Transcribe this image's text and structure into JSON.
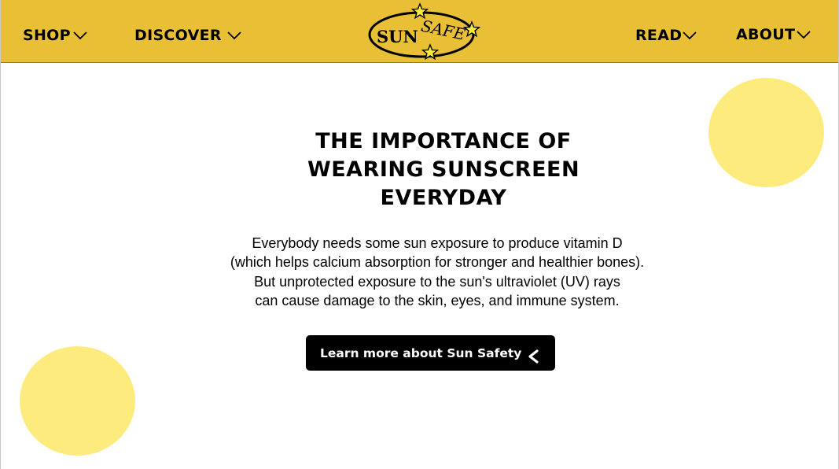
{
  "nav": {
    "shop": "SHOP",
    "discover": "DISCOVER",
    "read": "READ",
    "about": "ABOUT"
  },
  "logo": {
    "sun": "SUN",
    "safe": "SAFE"
  },
  "hero": {
    "title_lines": [
      "THE IMPORTANCE OF",
      "WEARING SUNSCREEN",
      "EVERYDAY"
    ],
    "body_lines": [
      "Everybody needs some sun exposure to produce vitamin D",
      "(which helps calcium absorption for stronger and healthier bones).",
      "But unprotected exposure to the sun's ultraviolet (UV) rays",
      "can cause damage to the skin, eyes, and immune system."
    ],
    "cta_label": "Learn more about Sun Safety"
  },
  "icons": {
    "chevron": "chevron-down-icon",
    "cta": "chevron-left-icon",
    "star": "star-icon"
  },
  "colors": {
    "nav_bg": "#e8bf35",
    "circle": "#fdeb7e",
    "button_bg": "#000000",
    "button_text": "#ffffff",
    "star_fill": "#f7ea3a"
  }
}
